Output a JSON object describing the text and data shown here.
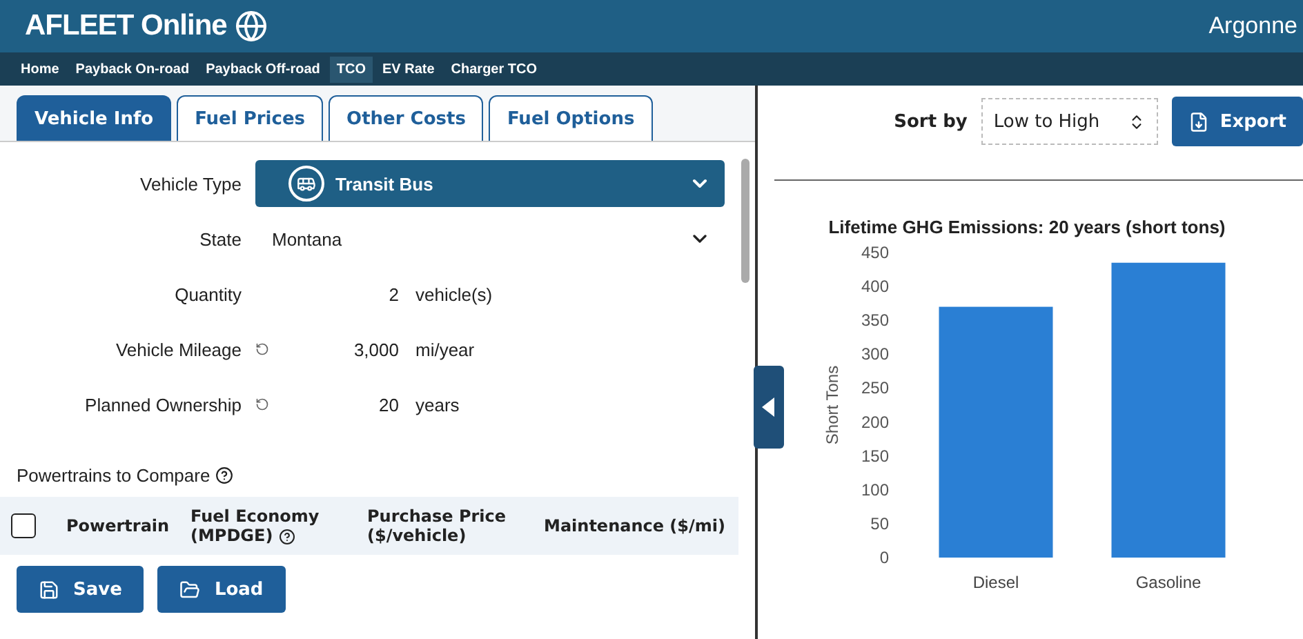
{
  "header": {
    "title": "AFLEET Online",
    "logo_text": "Argonne"
  },
  "nav": [
    {
      "label": "Home",
      "selected": false
    },
    {
      "label": "Payback On-road",
      "selected": false
    },
    {
      "label": "Payback Off-road",
      "selected": false
    },
    {
      "label": "TCO",
      "selected": true
    },
    {
      "label": "EV Rate",
      "selected": false
    },
    {
      "label": "Charger TCO",
      "selected": false
    }
  ],
  "tabs": [
    {
      "label": "Vehicle Info",
      "selected": true
    },
    {
      "label": "Fuel Prices",
      "selected": false
    },
    {
      "label": "Other Costs",
      "selected": false
    },
    {
      "label": "Fuel Options",
      "selected": false
    }
  ],
  "form": [
    {
      "kind": "vehicle",
      "label": "Vehicle Type",
      "value": "Transit Bus"
    },
    {
      "kind": "select",
      "label": "State",
      "value": "Montana"
    },
    {
      "kind": "number",
      "label": "Quantity",
      "value": "2",
      "unit": "vehicle(s)",
      "resettable": false
    },
    {
      "kind": "number",
      "label": "Vehicle Mileage",
      "value": "3,000",
      "unit": "mi/year",
      "resettable": true
    },
    {
      "kind": "number",
      "label": "Planned Ownership",
      "value": "20",
      "unit": "years",
      "resettable": true
    }
  ],
  "powertrains": {
    "title": "Powertrains to Compare",
    "all_checked": false,
    "columns": [
      {
        "label": "Powertrain",
        "help": false
      },
      {
        "label": "Fuel Economy (MPDGE)",
        "help": true
      },
      {
        "label": "Purchase Price ($/vehicle)",
        "help": false
      },
      {
        "label": "Maintenance ($/mi)",
        "help": false
      }
    ]
  },
  "buttons": [
    {
      "kind": "save",
      "label": "Save"
    },
    {
      "kind": "load",
      "label": "Load"
    }
  ],
  "sort": {
    "label": "Sort by",
    "value": "Low to High"
  },
  "export_button": "Export",
  "chart_data": {
    "type": "bar",
    "title": "Lifetime GHG Emissions: 20 years (short tons)",
    "ylabel": "Short Tons",
    "categories": [
      "Diesel",
      "Gasoline"
    ],
    "series": [
      {
        "color": "#2a7fd4",
        "values": [
          370,
          435
        ]
      }
    ],
    "ylim": [
      0,
      450
    ],
    "yticks": [
      0,
      50,
      100,
      150,
      200,
      250,
      300,
      350,
      400,
      450
    ]
  }
}
